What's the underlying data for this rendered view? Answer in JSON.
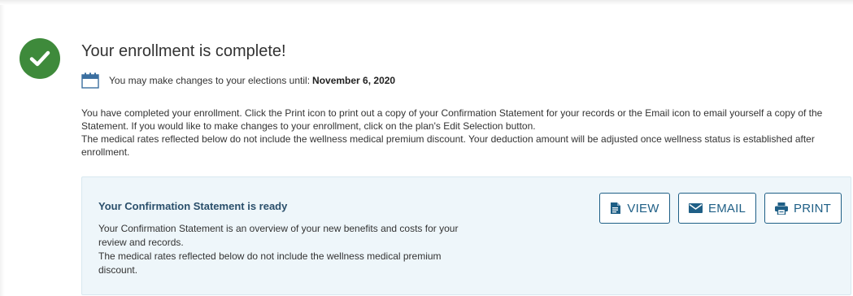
{
  "header": {
    "title": "Your enrollment is complete!"
  },
  "deadline": {
    "text": "You may make changes to your elections until:",
    "date": "November 6, 2020"
  },
  "body": {
    "line1": "You have completed your enrollment. Click the Print icon to print out a copy of your Confirmation Statement for your records or the Email icon to email yourself a copy of the Statement. If you would like to make changes to your enrollment, click on the plan's Edit Selection button.",
    "line2": "The medical rates reflected below do not include the wellness medical premium discount. Your deduction amount will be adjusted once wellness status is established after enrollment."
  },
  "panel": {
    "title": "Your Confirmation Statement is ready",
    "desc1": "Your Confirmation Statement is an overview of your new benefits and costs for your review and records.",
    "desc2": "The medical rates reflected below do not include the wellness medical premium discount."
  },
  "actions": {
    "view": "VIEW",
    "email": "EMAIL",
    "print": "PRINT"
  },
  "colors": {
    "success": "#3e8a3b",
    "accent": "#1f5f86",
    "panel_bg": "#eef6fa",
    "panel_title": "#2a4f6b"
  },
  "icons": {
    "status": "check-circle-icon",
    "deadline": "calendar-icon",
    "view": "document-icon",
    "email": "envelope-icon",
    "print": "printer-icon"
  }
}
